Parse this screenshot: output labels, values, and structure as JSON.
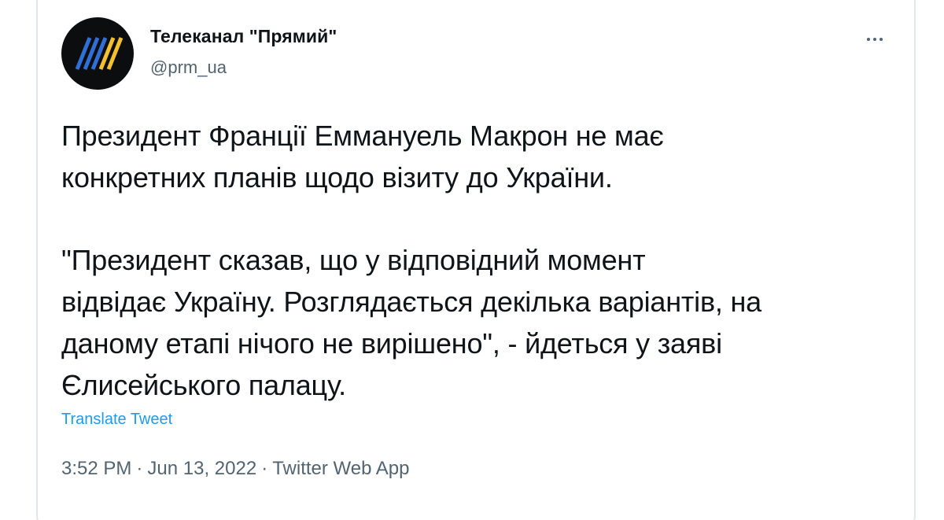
{
  "author": {
    "display_name": "Телеканал \"Прямий\"",
    "handle": "@prm_ua",
    "avatar_icon": "prm-stripes-logo-icon"
  },
  "header": {
    "more_icon": "more-horizontal-icon"
  },
  "tweet": {
    "paragraph_1": "Президент Франції Еммануель Макрон не має\nконкретних планів щодо візиту до України.",
    "paragraph_2": "\"Президент сказав, що у відповідний момент\nвідвідає Україну. Розглядається декілька варіантів, на\nданому етапі нічого не вирішено\", - йдеться у заяві\nЄлисейського палацу.",
    "translate_label": "Translate Tweet"
  },
  "meta": {
    "time": "3:52 PM",
    "separator": "·",
    "date": "Jun 13, 2022",
    "source": "Twitter Web App"
  },
  "colors": {
    "text_primary": "#0f1419",
    "text_secondary": "#536471",
    "link": "#1d9bf0",
    "border": "#e2e6e9",
    "avatar_bg": "#0c0d0f",
    "logo_blue": "#2f6fd6",
    "logo_yellow": "#f2c12e"
  }
}
